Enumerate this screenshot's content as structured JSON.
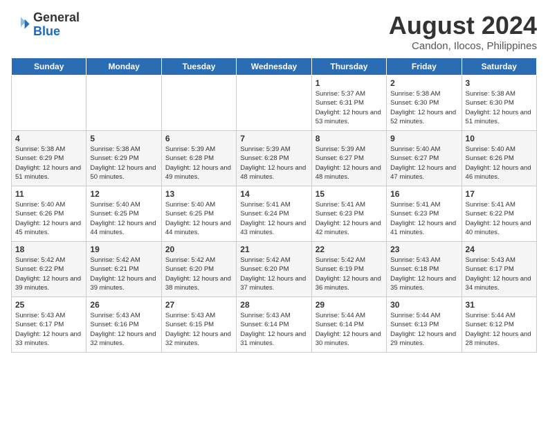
{
  "header": {
    "logo_line1": "General",
    "logo_line2": "Blue",
    "month": "August 2024",
    "location": "Candon, Ilocos, Philippines"
  },
  "days_of_week": [
    "Sunday",
    "Monday",
    "Tuesday",
    "Wednesday",
    "Thursday",
    "Friday",
    "Saturday"
  ],
  "weeks": [
    [
      {
        "day": "",
        "content": ""
      },
      {
        "day": "",
        "content": ""
      },
      {
        "day": "",
        "content": ""
      },
      {
        "day": "",
        "content": ""
      },
      {
        "day": "1",
        "content": "Sunrise: 5:37 AM\nSunset: 6:31 PM\nDaylight: 12 hours\nand 53 minutes."
      },
      {
        "day": "2",
        "content": "Sunrise: 5:38 AM\nSunset: 6:30 PM\nDaylight: 12 hours\nand 52 minutes."
      },
      {
        "day": "3",
        "content": "Sunrise: 5:38 AM\nSunset: 6:30 PM\nDaylight: 12 hours\nand 51 minutes."
      }
    ],
    [
      {
        "day": "4",
        "content": "Sunrise: 5:38 AM\nSunset: 6:29 PM\nDaylight: 12 hours\nand 51 minutes."
      },
      {
        "day": "5",
        "content": "Sunrise: 5:38 AM\nSunset: 6:29 PM\nDaylight: 12 hours\nand 50 minutes."
      },
      {
        "day": "6",
        "content": "Sunrise: 5:39 AM\nSunset: 6:28 PM\nDaylight: 12 hours\nand 49 minutes."
      },
      {
        "day": "7",
        "content": "Sunrise: 5:39 AM\nSunset: 6:28 PM\nDaylight: 12 hours\nand 48 minutes."
      },
      {
        "day": "8",
        "content": "Sunrise: 5:39 AM\nSunset: 6:27 PM\nDaylight: 12 hours\nand 48 minutes."
      },
      {
        "day": "9",
        "content": "Sunrise: 5:40 AM\nSunset: 6:27 PM\nDaylight: 12 hours\nand 47 minutes."
      },
      {
        "day": "10",
        "content": "Sunrise: 5:40 AM\nSunset: 6:26 PM\nDaylight: 12 hours\nand 46 minutes."
      }
    ],
    [
      {
        "day": "11",
        "content": "Sunrise: 5:40 AM\nSunset: 6:26 PM\nDaylight: 12 hours\nand 45 minutes."
      },
      {
        "day": "12",
        "content": "Sunrise: 5:40 AM\nSunset: 6:25 PM\nDaylight: 12 hours\nand 44 minutes."
      },
      {
        "day": "13",
        "content": "Sunrise: 5:40 AM\nSunset: 6:25 PM\nDaylight: 12 hours\nand 44 minutes."
      },
      {
        "day": "14",
        "content": "Sunrise: 5:41 AM\nSunset: 6:24 PM\nDaylight: 12 hours\nand 43 minutes."
      },
      {
        "day": "15",
        "content": "Sunrise: 5:41 AM\nSunset: 6:23 PM\nDaylight: 12 hours\nand 42 minutes."
      },
      {
        "day": "16",
        "content": "Sunrise: 5:41 AM\nSunset: 6:23 PM\nDaylight: 12 hours\nand 41 minutes."
      },
      {
        "day": "17",
        "content": "Sunrise: 5:41 AM\nSunset: 6:22 PM\nDaylight: 12 hours\nand 40 minutes."
      }
    ],
    [
      {
        "day": "18",
        "content": "Sunrise: 5:42 AM\nSunset: 6:22 PM\nDaylight: 12 hours\nand 39 minutes."
      },
      {
        "day": "19",
        "content": "Sunrise: 5:42 AM\nSunset: 6:21 PM\nDaylight: 12 hours\nand 39 minutes."
      },
      {
        "day": "20",
        "content": "Sunrise: 5:42 AM\nSunset: 6:20 PM\nDaylight: 12 hours\nand 38 minutes."
      },
      {
        "day": "21",
        "content": "Sunrise: 5:42 AM\nSunset: 6:20 PM\nDaylight: 12 hours\nand 37 minutes."
      },
      {
        "day": "22",
        "content": "Sunrise: 5:42 AM\nSunset: 6:19 PM\nDaylight: 12 hours\nand 36 minutes."
      },
      {
        "day": "23",
        "content": "Sunrise: 5:43 AM\nSunset: 6:18 PM\nDaylight: 12 hours\nand 35 minutes."
      },
      {
        "day": "24",
        "content": "Sunrise: 5:43 AM\nSunset: 6:17 PM\nDaylight: 12 hours\nand 34 minutes."
      }
    ],
    [
      {
        "day": "25",
        "content": "Sunrise: 5:43 AM\nSunset: 6:17 PM\nDaylight: 12 hours\nand 33 minutes."
      },
      {
        "day": "26",
        "content": "Sunrise: 5:43 AM\nSunset: 6:16 PM\nDaylight: 12 hours\nand 32 minutes."
      },
      {
        "day": "27",
        "content": "Sunrise: 5:43 AM\nSunset: 6:15 PM\nDaylight: 12 hours\nand 32 minutes."
      },
      {
        "day": "28",
        "content": "Sunrise: 5:43 AM\nSunset: 6:14 PM\nDaylight: 12 hours\nand 31 minutes."
      },
      {
        "day": "29",
        "content": "Sunrise: 5:44 AM\nSunset: 6:14 PM\nDaylight: 12 hours\nand 30 minutes."
      },
      {
        "day": "30",
        "content": "Sunrise: 5:44 AM\nSunset: 6:13 PM\nDaylight: 12 hours\nand 29 minutes."
      },
      {
        "day": "31",
        "content": "Sunrise: 5:44 AM\nSunset: 6:12 PM\nDaylight: 12 hours\nand 28 minutes."
      }
    ]
  ]
}
